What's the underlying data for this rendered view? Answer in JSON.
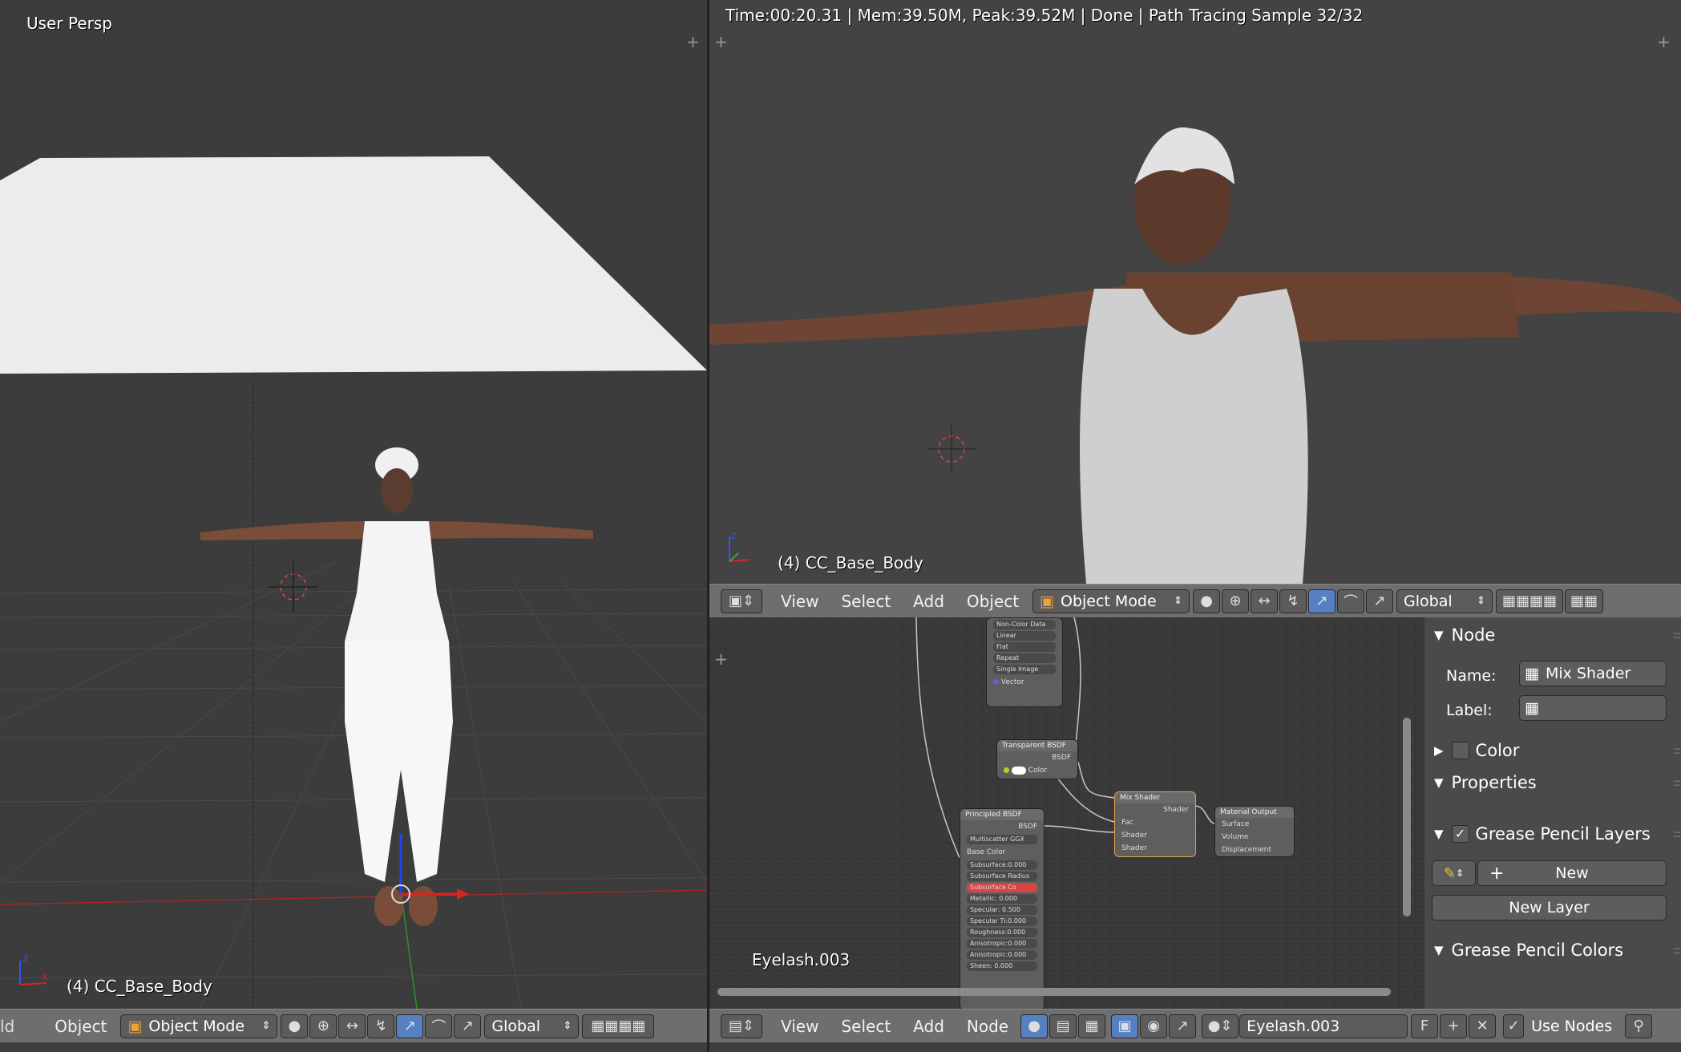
{
  "left_viewport": {
    "view_label": "User Persp",
    "object_label": "(4) CC_Base_Body",
    "header": {
      "cut_label": "ld",
      "object_menu": "Object",
      "mode": "Object Mode",
      "orientation": "Global"
    }
  },
  "right_viewport": {
    "render_status": "Time:00:20.31 | Mem:39.50M, Peak:39.52M | Done | Path Tracing Sample 32/32",
    "object_label": "(4) CC_Base_Body",
    "header": {
      "menus": [
        "View",
        "Select",
        "Add",
        "Object"
      ],
      "mode": "Object Mode",
      "orientation": "Global"
    }
  },
  "node_editor": {
    "material_overlay": "Eyelash.003",
    "nodes": {
      "image": {
        "fields": [
          "Non-Color Data",
          "Linear",
          "Flat",
          "Repeat",
          "Single Image"
        ],
        "input": "Vector"
      },
      "transparent": {
        "title": "Transparent BSDF",
        "output": "BSDF",
        "input": "Color"
      },
      "mix": {
        "title": "Mix Shader",
        "output": "Shader",
        "inputs": [
          "Fac",
          "Shader",
          "Shader"
        ]
      },
      "output": {
        "title": "Material Output",
        "inputs": [
          "Surface",
          "Volume",
          "Displacement"
        ]
      },
      "principled": {
        "title": "Principled BSDF",
        "output": "BSDF",
        "distribution": "Multiscatter GGX",
        "base": "Base Color",
        "fields": [
          "Subsurface:0.000",
          "Subsurface Radius",
          "Subsurface Co",
          "Metallic:       0.000",
          "Specular:      0.500",
          "Specular Ti:0.000",
          "Roughness:0.000",
          "Anisotropic:0.000",
          "Anisotropic:0.000",
          "Sheen:         0.000"
        ]
      }
    },
    "header": {
      "menus": [
        "View",
        "Select",
        "Add",
        "Node"
      ],
      "material_name": "Eyelash.003",
      "fake_user": "F",
      "use_nodes_label": "Use Nodes",
      "use_nodes_checked": true
    }
  },
  "properties_panel": {
    "node_section": "Node",
    "name_label": "Name:",
    "name_value": "Mix Shader",
    "label_label": "Label:",
    "label_value": "",
    "color_section": "Color",
    "properties_section": "Properties",
    "gp_layers_section": "Grease Pencil Layers",
    "new_button": "New",
    "new_layer_button": "New Layer",
    "gp_colors_section": "Grease Pencil Colors"
  },
  "colors": {
    "accent_blue": "#5680c2",
    "header_gray": "#6e6e6e",
    "axis_red": "#d42a2a",
    "axis_green": "#3aa63a",
    "socket_yellow": "#c7c729"
  }
}
